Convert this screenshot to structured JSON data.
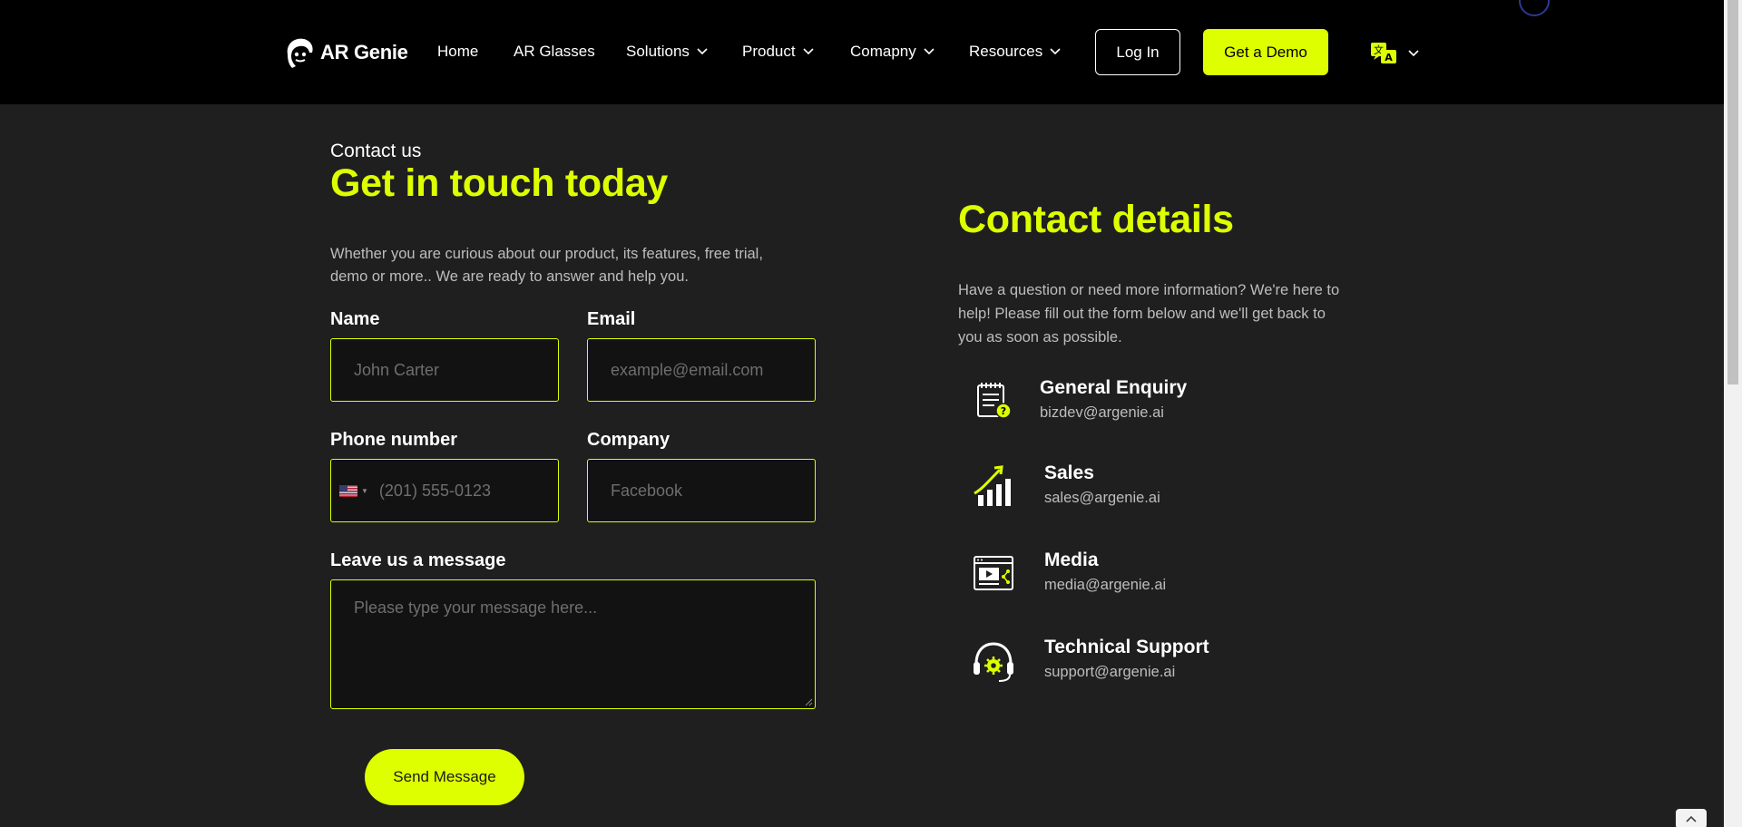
{
  "brand": {
    "name": "AR Genie",
    "accent": "#ddff00"
  },
  "nav": {
    "items": [
      {
        "label": "Home",
        "dropdown": false
      },
      {
        "label": "AR Glasses",
        "dropdown": false
      },
      {
        "label": "Solutions",
        "dropdown": true
      },
      {
        "label": "Product",
        "dropdown": true
      },
      {
        "label": "Comapny",
        "dropdown": true
      },
      {
        "label": "Resources",
        "dropdown": true
      }
    ],
    "login_label": "Log In",
    "demo_label": "Get a Demo",
    "language_icon": "translate-icon"
  },
  "form": {
    "eyebrow": "Contact us",
    "title": "Get in touch today",
    "intro": "Whether you are curious about our product, its features, free trial, demo or more.. We are ready to answer and help you.",
    "name_label": "Name",
    "name_placeholder": "John Carter",
    "email_label": "Email",
    "email_placeholder": "example@email.com",
    "phone_label": "Phone number",
    "phone_placeholder": "(201) 555-0123",
    "phone_country_icon": "us-flag-icon",
    "company_label": "Company",
    "company_placeholder": "Facebook",
    "message_label": "Leave us a message",
    "message_placeholder": "Please type your message here...",
    "send_label": "Send Message"
  },
  "details": {
    "title": "Contact details",
    "description": "Have a question or need more information? We're here to help! Please fill out the form below and we'll get back to you as soon as possible.",
    "contacts": [
      {
        "title": "General Enquiry",
        "email": "bizdev@argenie.ai",
        "icon": "enquiry-icon"
      },
      {
        "title": "Sales",
        "email": "sales@argenie.ai",
        "icon": "sales-chart-icon"
      },
      {
        "title": "Media",
        "email": "media@argenie.ai",
        "icon": "media-icon"
      },
      {
        "title": "Technical Support",
        "email": "support@argenie.ai",
        "icon": "headset-icon"
      }
    ]
  }
}
